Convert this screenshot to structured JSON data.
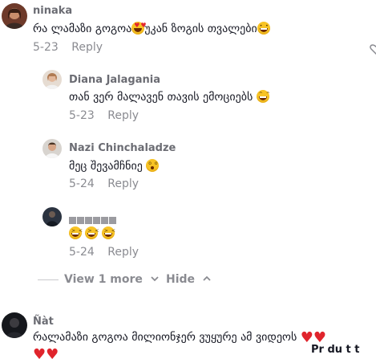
{
  "comments": [
    {
      "name": "ninaka",
      "text": "რა ლამაზი გოგოა",
      "text_after": "უკან ზოგის თვალები",
      "date": "5-23",
      "reply_label": "Reply"
    }
  ],
  "replies": [
    {
      "name": "Diana Jalagania",
      "text": "თან ვერ მალავენ თავის ემოციებს",
      "date": "5-23",
      "reply_label": "Reply"
    },
    {
      "name": "Nazi Chinchaladze",
      "text": "მეც შევამჩნიე",
      "date": "5-24",
      "reply_label": "Reply"
    },
    {
      "name": "",
      "text": "",
      "date": "5-24",
      "reply_label": "Reply"
    }
  ],
  "thread_controls": {
    "view_more_label": "View 1 more",
    "hide_label": "Hide"
  },
  "next_comment": {
    "name": "Ñàt",
    "text": "რალამაზი გოგოა მილიონჯერ ვუყურე ამ ვიდეოს",
    "cut_off_text": "Pr du t t"
  },
  "colors": {
    "name_gray": "#6b6c73",
    "meta_gray": "#8a8b91",
    "text_dark": "#161823",
    "heart_red": "#e0242c",
    "emoji_yellow": "#f7c325"
  },
  "icons": {
    "chevron_down": "chevron-down-icon",
    "chevron_up": "chevron-up-icon",
    "like_heart": "heart-outline-icon"
  }
}
